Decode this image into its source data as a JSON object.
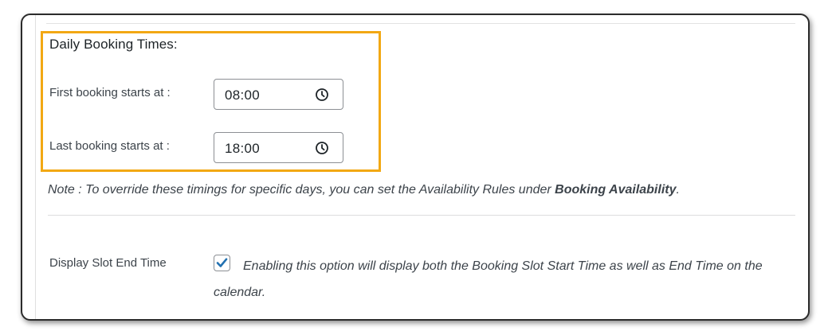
{
  "daily_booking": {
    "title": "Daily Booking Times:",
    "first": {
      "label": "First booking starts at :",
      "value": "08:00"
    },
    "last": {
      "label": "Last booking starts at :",
      "value": "18:00"
    }
  },
  "note": {
    "text": "Note : To override these timings for specific days, you can set the Availability Rules under ",
    "link": "Booking Availability",
    "suffix": "."
  },
  "display_slot_end_time": {
    "label": "Display Slot End Time",
    "checked": true,
    "description": "Enabling this option will display both the Booking Slot Start Time as well as End Time on the calendar."
  },
  "colors": {
    "highlight": "#f2a813",
    "checkmark": "#2271b1"
  },
  "icons": {
    "time_picker": "clock-icon",
    "checkbox_state": "checkmark-icon"
  }
}
